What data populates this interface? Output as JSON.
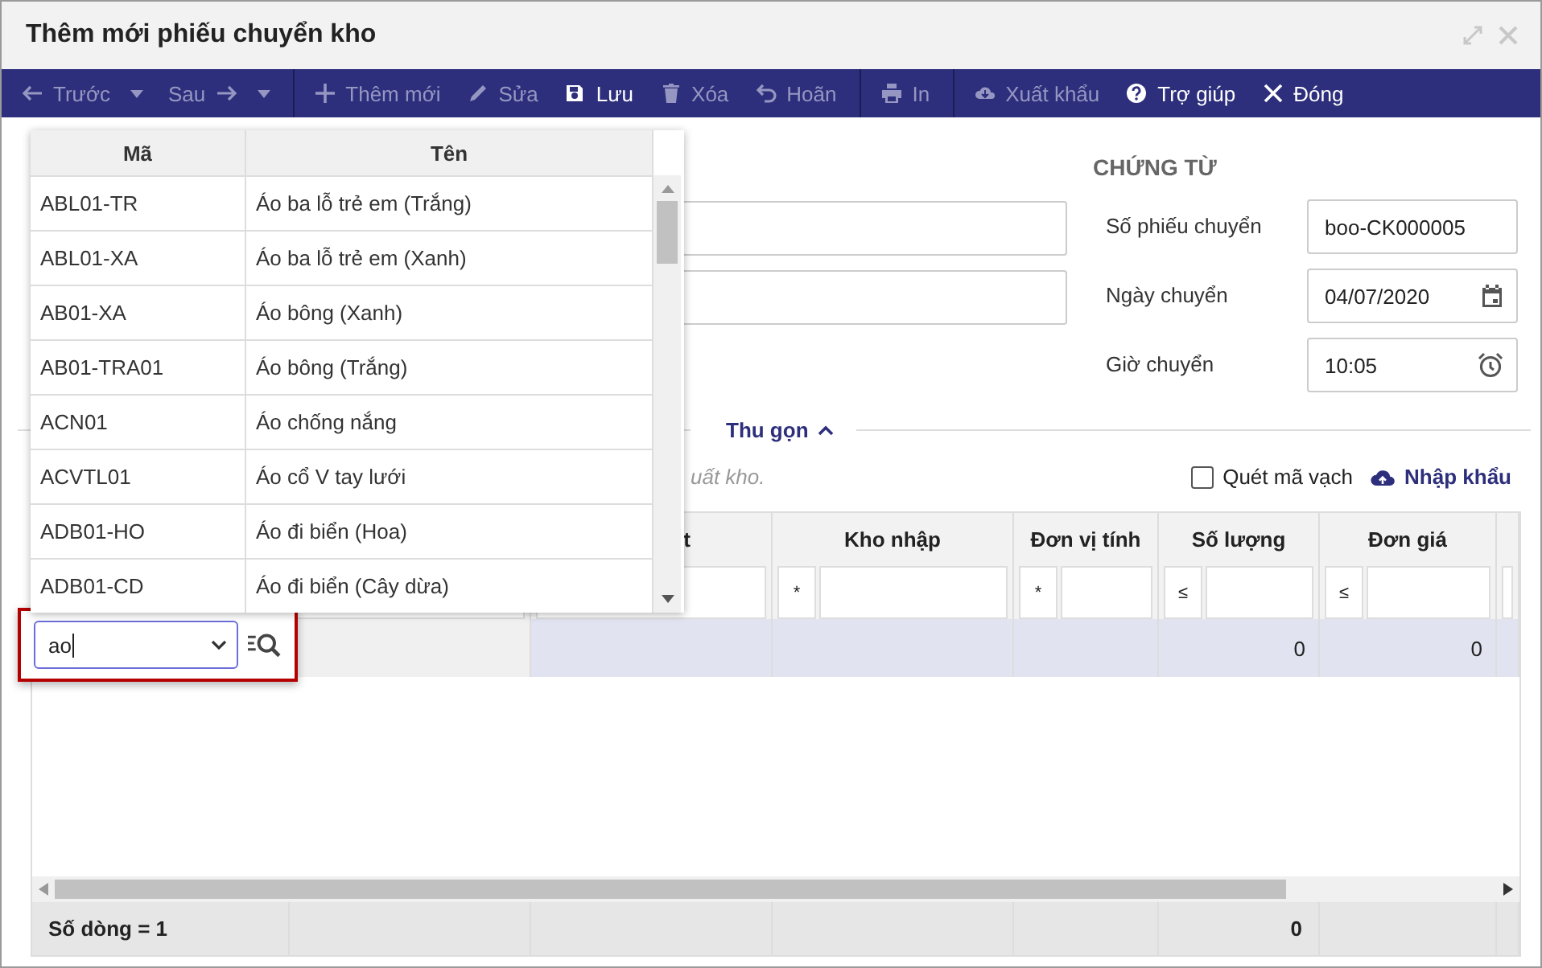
{
  "window": {
    "title": "Thêm mới phiếu chuyển kho"
  },
  "toolbar": {
    "groups": [
      [
        {
          "label": "Trước",
          "kind": "back",
          "disabled": true
        },
        {
          "label": "Sau",
          "kind": "next",
          "disabled": true
        }
      ],
      [
        {
          "label": "Thêm mới",
          "kind": "add",
          "disabled": true
        },
        {
          "label": "Sửa",
          "kind": "edit",
          "disabled": true
        },
        {
          "label": "Lưu",
          "kind": "save",
          "disabled": false
        },
        {
          "label": "Xóa",
          "kind": "delete",
          "disabled": true
        },
        {
          "label": "Hoãn",
          "kind": "undo",
          "disabled": true
        }
      ],
      [
        {
          "label": "In",
          "kind": "print",
          "disabled": true
        }
      ],
      [
        {
          "label": "Xuất khẩu",
          "kind": "export",
          "disabled": true
        },
        {
          "label": "Trợ giúp",
          "kind": "help",
          "disabled": false
        },
        {
          "label": "Đóng",
          "kind": "close",
          "disabled": false
        }
      ]
    ]
  },
  "voucher": {
    "heading": "CHỨNG TỪ",
    "fields": [
      {
        "label": "Số phiếu chuyển",
        "value": "boo-CK000005",
        "kind": "text"
      },
      {
        "label": "Ngày chuyển",
        "value": "04/07/2020",
        "kind": "date"
      },
      {
        "label": "Giờ chuyển",
        "value": "10:05",
        "kind": "time"
      }
    ]
  },
  "collapse": {
    "label": "Thu gọn",
    "expanded": true
  },
  "hint": "uất kho.",
  "barcode": {
    "label": "Quét mã vạch",
    "checked": false
  },
  "import_link": "Nhập khẩu",
  "grid": {
    "columns": [
      {
        "kind": "hidden"
      },
      {
        "kind": "hidden"
      },
      {
        "kind": "text",
        "heading": "t"
      },
      {
        "kind": "text",
        "heading": "Kho nhập",
        "filter_op": "*"
      },
      {
        "kind": "text",
        "heading": "Đơn vị tính",
        "filter_op": "*"
      },
      {
        "kind": "number",
        "heading": "Số lượng",
        "filter_op": "≤",
        "value": "0",
        "total": "0"
      },
      {
        "kind": "number",
        "heading": "Đơn giá",
        "filter_op": "≤",
        "value": "0"
      },
      {
        "kind": "cut"
      }
    ],
    "editor": {
      "value": "ao"
    },
    "row_count": "Số dòng = 1"
  },
  "lookup": {
    "columns": [
      "Mã",
      "Tên"
    ],
    "rows": [
      {
        "code": "ABL01-TR",
        "name": "Áo ba lỗ trẻ em (Trắng)"
      },
      {
        "code": "ABL01-XA",
        "name": "Áo ba lỗ trẻ em (Xanh)"
      },
      {
        "code": "AB01-XA",
        "name": "Áo bông (Xanh)"
      },
      {
        "code": "AB01-TRA01",
        "name": "Áo bông (Trắng)"
      },
      {
        "code": "ACN01",
        "name": "Áo chống nắng"
      },
      {
        "code": "ACVTL01",
        "name": "Áo cổ V tay lưới"
      },
      {
        "code": "ADB01-HO",
        "name": "Áo đi biển (Hoa)"
      },
      {
        "code": "ADB01-CD",
        "name": "Áo đi biển (Cây dừa)"
      }
    ]
  }
}
